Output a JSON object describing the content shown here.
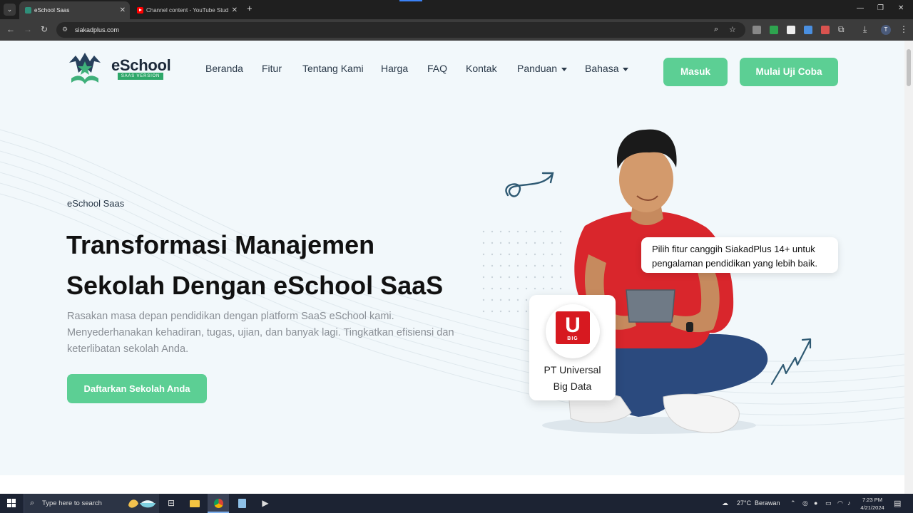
{
  "browser": {
    "tabs": [
      {
        "title": "eSchool Saas",
        "active": true,
        "favicon": "eschool-favicon"
      },
      {
        "title": "Channel content - YouTube Studio",
        "active": false,
        "favicon": "youtube-favicon"
      }
    ],
    "url": "siakadplus.com"
  },
  "site": {
    "logo": {
      "name": "eSchool",
      "badge": "SAAS VERSION"
    },
    "nav": [
      {
        "label": "Beranda"
      },
      {
        "label": "Fitur"
      },
      {
        "label": "Tentang Kami"
      },
      {
        "label": "Harga"
      },
      {
        "label": "FAQ"
      },
      {
        "label": "Kontak"
      },
      {
        "label": "Panduan",
        "dropdown": true
      },
      {
        "label": "Bahasa",
        "dropdown": true
      }
    ],
    "buttons": {
      "login": "Masuk",
      "trial": "Mulai Uji Coba"
    },
    "colors": {
      "accent": "#5ccf94",
      "heading": "#111111",
      "page_bg": "#f2f8fb",
      "brand_red": "#d71920"
    }
  },
  "hero": {
    "eyebrow": "eSchool Saas",
    "headline_line1": "Transformasi Manajemen",
    "headline_line2": "Sekolah Dengan eSchool SaaS",
    "subtext": "Rasakan masa depan pendidikan dengan platform SaaS eSchool kami. Menyederhanakan kehadiran, tugas, ujian, dan banyak lagi. Tingkatkan efisiensi dan keterlibatan sekolah Anda.",
    "cta": "Daftarkan Sekolah Anda",
    "bubble_text": "Pilih fitur canggih SiakadPlus 14+ untuk pengalaman pendidikan yang lebih baik.",
    "partner": {
      "logo_letter": "U",
      "logo_sub": "BIG",
      "name_line1": "PT Universal",
      "name_line2": "Big Data"
    }
  },
  "taskbar": {
    "search_placeholder": "Type here to search",
    "weather_temp": "27°C",
    "weather_text": "Berawan",
    "time": "7:23 PM",
    "date": "4/21/2024"
  }
}
